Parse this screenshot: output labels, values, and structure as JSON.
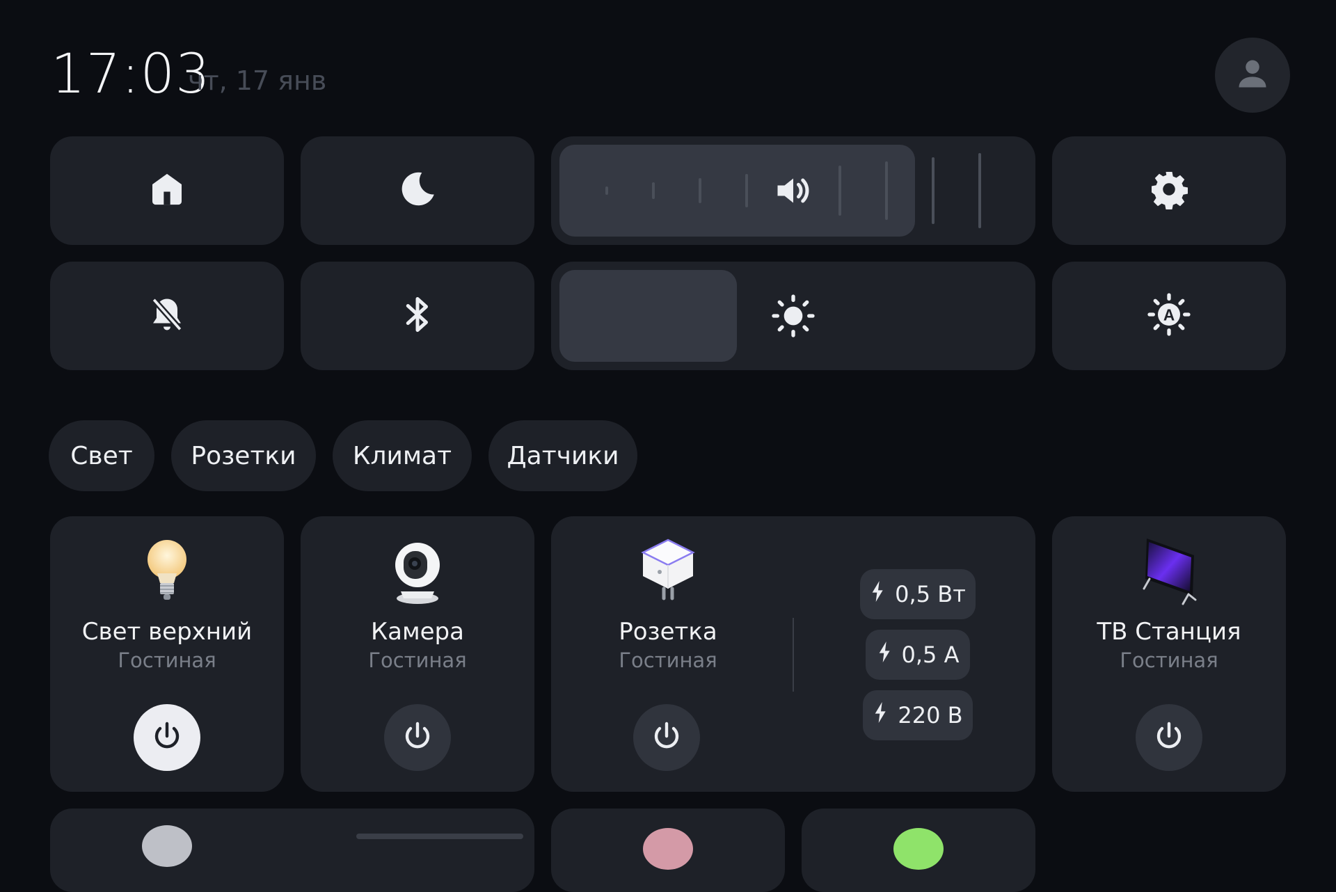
{
  "header": {
    "time": "17:03",
    "date": "чт, 17 янв"
  },
  "icons": {
    "avatar": "user-icon",
    "home": "home-icon",
    "moon": "moon-icon",
    "volume": "volume-icon",
    "settings": "gear-icon",
    "bell_off": "bell-off-icon",
    "bluetooth": "bluetooth-icon",
    "brightness": "sun-icon",
    "auto_brightness": "auto-brightness-icon",
    "power": "power-icon",
    "bolt": "bolt-icon"
  },
  "controls": {
    "volume_level": 0.76,
    "brightness_level": 0.38
  },
  "filters": [
    "Свет",
    "Розетки",
    "Климат",
    "Датчики"
  ],
  "devices": [
    {
      "title": "Свет верхний",
      "room": "Гостиная",
      "on": true,
      "icon": "bulb-icon"
    },
    {
      "title": "Камера",
      "room": "Гостиная",
      "on": false,
      "icon": "camera-icon"
    },
    {
      "title": "Розетка",
      "room": "Гостиная",
      "on": false,
      "icon": "socket-icon",
      "metrics": [
        "0,5 Вт",
        "0,5 А",
        "220 В"
      ]
    },
    {
      "title": "ТВ Станция",
      "room": "Гостиная",
      "on": false,
      "icon": "tv-icon"
    }
  ],
  "colors": {
    "background": "#0b0d12",
    "tile": "#1e2128",
    "fill": "#353943",
    "active_power": "#ecedf2"
  }
}
